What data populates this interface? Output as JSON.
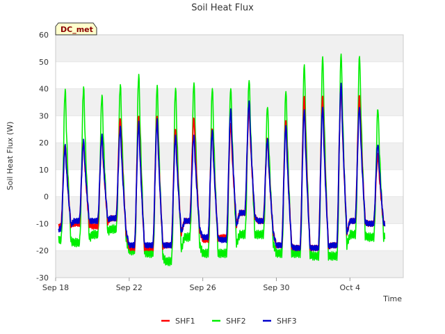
{
  "chart_data": {
    "type": "line",
    "title": "Soil Heat Flux",
    "xlabel": "Time",
    "ylabel": "Soil Heat Flux (W)",
    "station_label": "DC_met",
    "ylim": [
      -30,
      60
    ],
    "y_ticks": [
      -30,
      -20,
      -10,
      0,
      10,
      20,
      30,
      40,
      50,
      60
    ],
    "x_range_days": [
      "2023-09-18",
      "2023-10-06"
    ],
    "x_ticks": [
      {
        "date": "2023-09-18",
        "label": "Sep 18"
      },
      {
        "date": "2023-09-22",
        "label": "Sep 22"
      },
      {
        "date": "2023-09-26",
        "label": "Sep 26"
      },
      {
        "date": "2023-09-30",
        "label": "Sep 30"
      },
      {
        "date": "2023-10-04",
        "label": "Oct 4"
      }
    ],
    "grid": "horizontal alternating bands",
    "legend_position": "bottom-center",
    "series": [
      {
        "name": "SHF1",
        "color": "#ff0000"
      },
      {
        "name": "SHF2",
        "color": "#00ee00"
      },
      {
        "name": "SHF3",
        "color": "#0000cc"
      }
    ],
    "daily_cycles": [
      {
        "day": "2023-09-18",
        "min": [
          -11,
          -16,
          -12
        ],
        "max": [
          20,
          41,
          19
        ]
      },
      {
        "day": "2023-09-19",
        "min": [
          -10,
          -17,
          -9
        ],
        "max": [
          21,
          42,
          21
        ]
      },
      {
        "day": "2023-09-20",
        "min": [
          -11,
          -14,
          -9
        ],
        "max": [
          23,
          39,
          23
        ]
      },
      {
        "day": "2023-09-21",
        "min": [
          -8,
          -12,
          -8
        ],
        "max": [
          30,
          43,
          26
        ]
      },
      {
        "day": "2023-09-22",
        "min": [
          -19,
          -20,
          -18
        ],
        "max": [
          31,
          47,
          28
        ]
      },
      {
        "day": "2023-09-23",
        "min": [
          -19,
          -21,
          -18
        ],
        "max": [
          31,
          43,
          29
        ]
      },
      {
        "day": "2023-09-24",
        "min": [
          -18,
          -24,
          -18
        ],
        "max": [
          26,
          42,
          23
        ]
      },
      {
        "day": "2023-09-25",
        "min": [
          -9,
          -15,
          -9
        ],
        "max": [
          30,
          44,
          23
        ]
      },
      {
        "day": "2023-09-26",
        "min": [
          -16,
          -21,
          -15
        ],
        "max": [
          26,
          42,
          25
        ]
      },
      {
        "day": "2023-09-27",
        "min": [
          -15,
          -21,
          -16
        ],
        "max": [
          28,
          42,
          33
        ]
      },
      {
        "day": "2023-09-28",
        "min": [
          -6,
          -14,
          -6
        ],
        "max": [
          33,
          45,
          36
        ]
      },
      {
        "day": "2023-09-29",
        "min": [
          -9,
          -14,
          -9
        ],
        "max": [
          22,
          35,
          22
        ]
      },
      {
        "day": "2023-09-30",
        "min": [
          -18,
          -21,
          -18
        ],
        "max": [
          29,
          41,
          27
        ]
      },
      {
        "day": "2023-10-01",
        "min": [
          -19,
          -21,
          -19
        ],
        "max": [
          38,
          51,
          33
        ]
      },
      {
        "day": "2023-10-02",
        "min": [
          -19,
          -22,
          -19
        ],
        "max": [
          38,
          54,
          34
        ]
      },
      {
        "day": "2023-10-03",
        "min": [
          -18,
          -22,
          -18
        ],
        "max": [
          42,
          55,
          43
        ]
      },
      {
        "day": "2023-10-04",
        "min": [
          -9,
          -14,
          -9
        ],
        "max": [
          38,
          54,
          34
        ]
      },
      {
        "day": "2023-10-05",
        "min": [
          -10,
          -15,
          -10
        ],
        "max": [
          16,
          34,
          20
        ]
      }
    ]
  }
}
